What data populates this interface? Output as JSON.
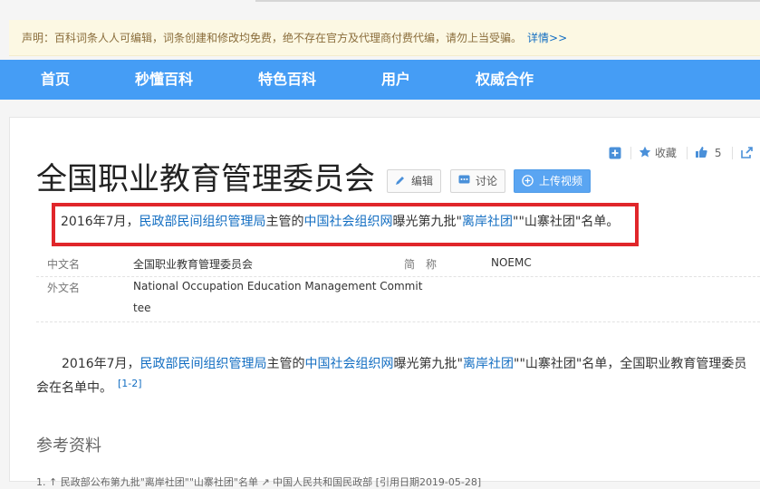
{
  "notice": {
    "text": "声明：百科词条人人可编辑，词条创建和修改均免费，绝不存在官方及代理商付费代编，请勿上当受骗。",
    "link": "详情>>"
  },
  "nav": {
    "items": [
      {
        "label": "首页"
      },
      {
        "label": "秒懂百科"
      },
      {
        "label": "特色百科"
      },
      {
        "label": "用户"
      },
      {
        "label": "权威合作"
      }
    ]
  },
  "toolbar": {
    "favorite_label": "收藏",
    "like_count": "5"
  },
  "entry": {
    "title": "全国职业教育管理委员会",
    "edit_label": "编辑",
    "discuss_label": "讨论",
    "upload_label": "上传视频"
  },
  "summary": {
    "t1": "2016年7月，",
    "l1": "民政部民间组织管理局",
    "t2": "主管的",
    "l2": "中国社会组织网",
    "t3": "曝光第九批\"",
    "l3": "离岸社团",
    "t4": "\"\"山寨社团\"名单。"
  },
  "info": {
    "cn_name_label": "中文名",
    "cn_name_value": "全国职业教育管理委员会",
    "abbr_label": "简称",
    "abbr_value": "NOEMC",
    "foreign_name_label": "外文名",
    "foreign_name_value_line1": "National Occupation Education Management Commit",
    "foreign_name_value_line2": "tee"
  },
  "para": {
    "t1": "2016年7月，",
    "l1": "民政部民间组织管理局",
    "t2": "主管的",
    "l2": "中国社会组织网",
    "t3": "曝光第九批\"",
    "l3": "离岸社团",
    "t4": "\"\"山寨社团\"名单，全国职业教育管理委员会在名单中。",
    "ref": "[1-2]"
  },
  "refs": {
    "title": "参考资料",
    "item1": "1. ↑ 民政部公布第九批\"离岸社团\"\"山寨社团\"名单 ↗    中国人民共和国民政部 [引用日期2019-05-28]"
  }
}
